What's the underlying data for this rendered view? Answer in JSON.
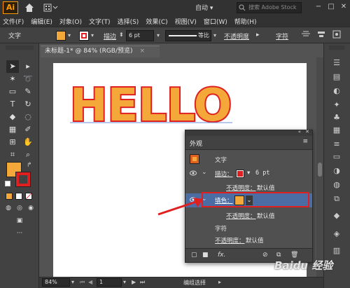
{
  "titlebar": {
    "logo": "Ai",
    "workspace": "自动",
    "search_placeholder": "搜索 Adobe Stock",
    "buttons": [
      "−",
      "□",
      "✕"
    ]
  },
  "menu": [
    "文件(F)",
    "编辑(E)",
    "对象(O)",
    "文字(T)",
    "选择(S)",
    "效果(C)",
    "视图(V)",
    "窗口(W)",
    "帮助(H)"
  ],
  "controlbar": {
    "label": "文字",
    "fill_color": "#f5a83a",
    "stroke_color": "#e02020",
    "stroke_label": "描边",
    "stroke_value": "6 pt",
    "line_style_label": "等比",
    "opacity_label": "不透明度",
    "char_label": "字符"
  },
  "document": {
    "tab_title": "未标题-1* @ 84% (RGB/预览)",
    "close": "×",
    "art_text": "HELLO"
  },
  "statusbar": {
    "zoom": "84%",
    "page": "1",
    "tool": "编组选择"
  },
  "appearance_panel": {
    "title": "外观",
    "rows": [
      {
        "label": "文字"
      },
      {
        "label": "描边：",
        "value": "6 pt"
      },
      {
        "label": "不透明度：",
        "value": "默认值"
      },
      {
        "label": "填色："
      },
      {
        "label": "不透明度：",
        "value": "默认值"
      },
      {
        "label": "字符"
      },
      {
        "label": "不透明度：",
        "value": "默认值"
      }
    ],
    "footer_fx": "fx."
  },
  "colors": {
    "fill": "#f5a83a",
    "stroke": "#e02020",
    "highlight": "#e02020",
    "panel_selected": "#4b6da3"
  },
  "watermark": "Baidu 经验"
}
